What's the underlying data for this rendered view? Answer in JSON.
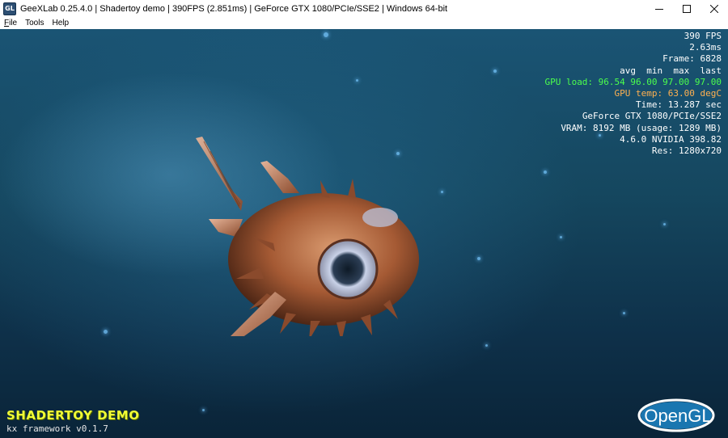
{
  "window": {
    "title": "GeeXLab 0.25.4.0 | Shadertoy demo | 390FPS (2.851ms) | GeForce GTX 1080/PCIe/SSE2 | Windows 64-bit",
    "icon": "geexlab-app-icon",
    "controls": {
      "minimize": "minimize-icon",
      "maximize": "maximize-icon",
      "close": "close-icon"
    }
  },
  "menu": {
    "items": [
      {
        "label": "File",
        "accel": "F",
        "rest": "ile"
      },
      {
        "label": "Tools"
      },
      {
        "label": "Help"
      }
    ]
  },
  "hud": {
    "fps": "390 FPS",
    "frametime": "2.63ms",
    "frame": "Frame: 6828",
    "header": "avg  min  max  last",
    "gpu_load": "GPU load: 96.54 96.00 97.00 97.00",
    "gpu_temp": "GPU temp: 63.00 degC",
    "time": "Time: 13.287 sec",
    "gpu_name": "GeForce GTX 1080/PCIe/SSE2",
    "vram": "VRAM: 8192 MB (usage: 1289 MB)",
    "driver": "4.6.0 NVIDIA 398.82",
    "res": "Res: 1280x720"
  },
  "demo": {
    "title": "SHADERTOY DEMO",
    "subtitle": "kx framework v0.1.7"
  },
  "logo": {
    "text": "OpenGL"
  },
  "colors": {
    "hud_text": "#ffffff",
    "gpu_load": "#4cff4c",
    "gpu_temp": "#ffb050",
    "demo_title": "#f0ff36",
    "scene_bg": "#15475f"
  }
}
